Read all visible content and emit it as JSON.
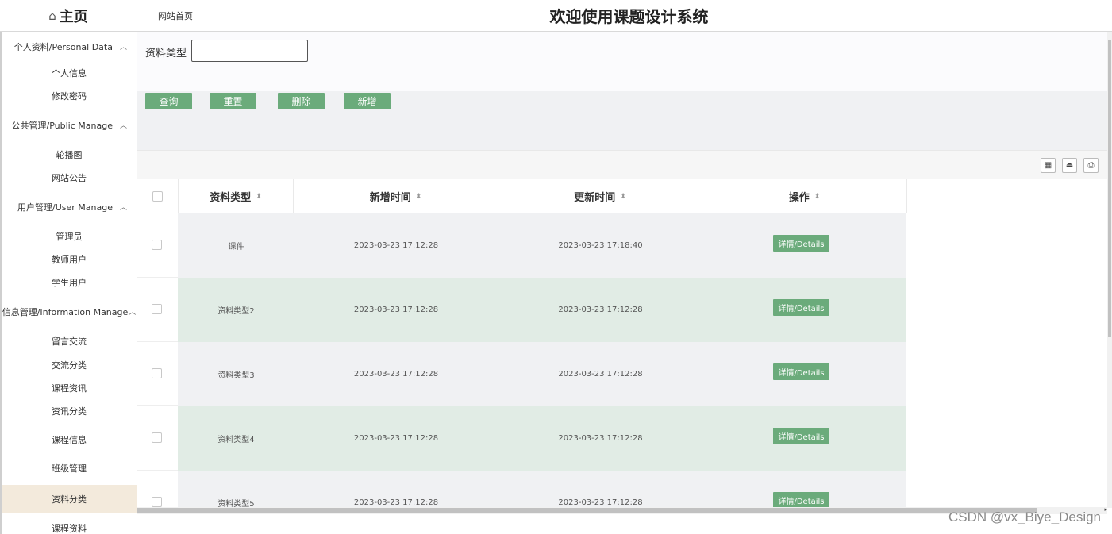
{
  "header": {
    "home_icon": "home-icon",
    "home_label": "主页",
    "breadcrumb": "网站首页",
    "title": "欢迎使用课题设计系统"
  },
  "sidebar": {
    "groups": [
      {
        "label": "个人资料/Personal Data",
        "items": [
          "个人信息",
          "修改密码"
        ]
      },
      {
        "label": "公共管理/Public Manage",
        "items": [
          "轮播图",
          "网站公告"
        ]
      },
      {
        "label": "用户管理/User Manage",
        "items": [
          "管理员",
          "教师用户",
          "学生用户"
        ]
      },
      {
        "label": "信息管理/Information Manage",
        "items": [
          "留言交流",
          "交流分类",
          "课程资讯",
          "资讯分类",
          "课程信息",
          "班级管理",
          "资料分类",
          "课程资料"
        ]
      }
    ],
    "active_item": "资料分类",
    "active_color": "#f3eadc"
  },
  "search": {
    "label": "资料类型",
    "value": "",
    "placeholder": ""
  },
  "buttons": {
    "query": "查询",
    "reset": "重置",
    "delete": "删除",
    "add": "新增",
    "color": "#6bab7b"
  },
  "toolbar_icons": [
    "columns-icon",
    "export-icon",
    "print-icon"
  ],
  "table": {
    "columns": [
      "资料类型",
      "新增时间",
      "更新时间",
      "操作"
    ],
    "rows": [
      {
        "type": "课件",
        "created": "2023-03-23 17:12:28",
        "updated": "2023-03-23 17:18:40",
        "action": "详情/Details"
      },
      {
        "type": "资料类型2",
        "created": "2023-03-23 17:12:28",
        "updated": "2023-03-23 17:12:28",
        "action": "详情/Details"
      },
      {
        "type": "资料类型3",
        "created": "2023-03-23 17:12:28",
        "updated": "2023-03-23 17:12:28",
        "action": "详情/Details"
      },
      {
        "type": "资料类型4",
        "created": "2023-03-23 17:12:28",
        "updated": "2023-03-23 17:12:28",
        "action": "详情/Details"
      },
      {
        "type": "资料类型5",
        "created": "2023-03-23 17:12:28",
        "updated": "2023-03-23 17:12:28",
        "action": "详情/Details"
      }
    ],
    "row_colors": [
      "#f0f1f3",
      "#e1ece5"
    ]
  },
  "watermark": "CSDN @vx_Biye_Design"
}
